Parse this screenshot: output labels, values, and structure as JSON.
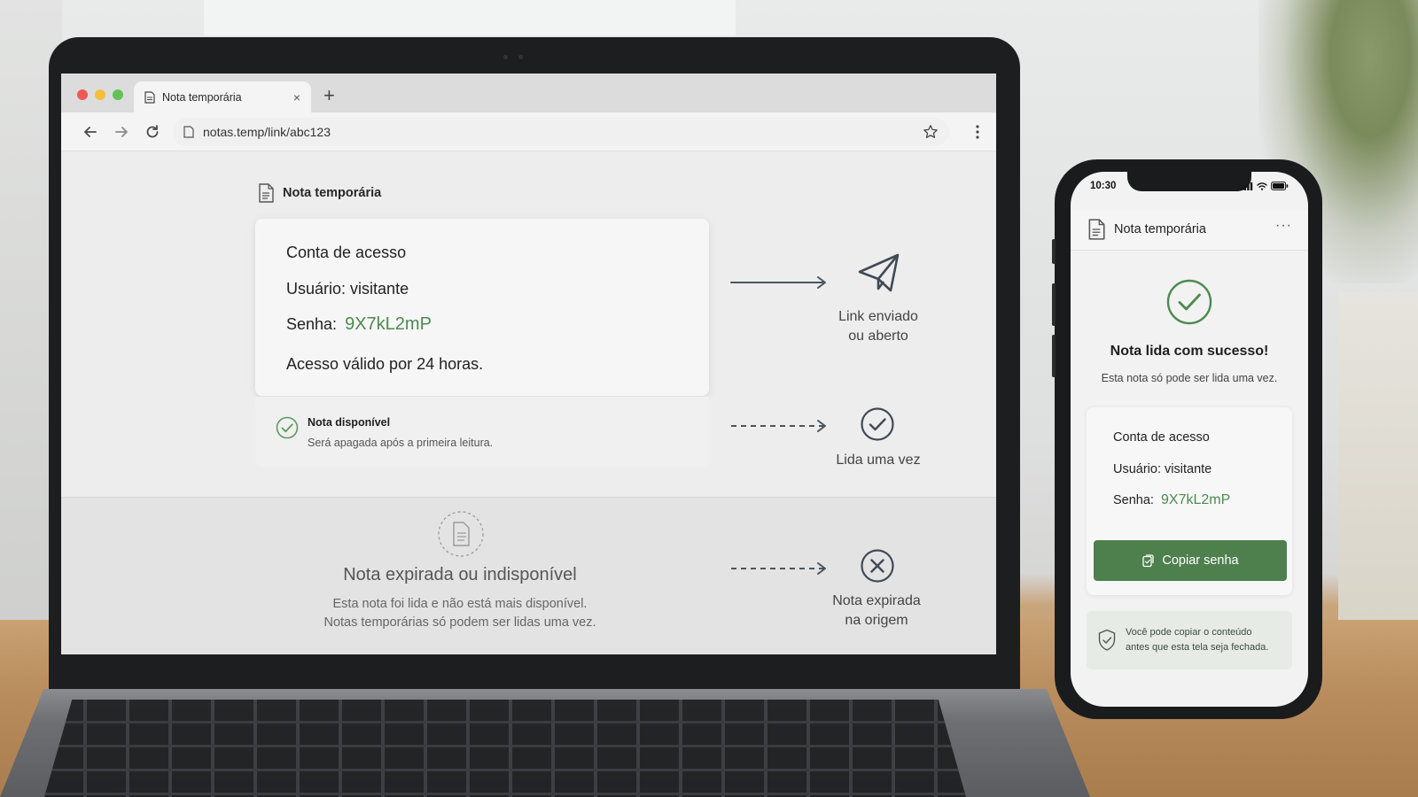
{
  "browser": {
    "tab_title": "Nota temporária",
    "tab_close": "×",
    "new_tab": "+",
    "url": "notas.temp/link/abc123"
  },
  "page": {
    "header": "Nota temporária",
    "card": {
      "title": "Conta de acesso",
      "user_label": "Usuário:",
      "user_value": "visitante",
      "pass_label": "Senha:",
      "pass_value": "9X7kL2mP",
      "validity": "Acesso válido por 24 horas."
    },
    "status": {
      "title": "Nota disponível",
      "subtitle": "Será apagada após a primeira leitura."
    },
    "flow": {
      "step1_line1": "Link enviado",
      "step1_line2": "ou aberto",
      "step2": "Lida uma vez",
      "step3_line1": "Nota expirada",
      "step3_line2": "na origem"
    },
    "expired": {
      "title": "Nota expirada ou indisponível",
      "line1": "Esta nota foi lida e não está mais disponível.",
      "line2": "Notas temporárias só podem ser lidas uma vez."
    }
  },
  "phone": {
    "time": "10:30",
    "header_title": "Nota temporária",
    "more": "···",
    "success_title": "Nota lida com sucesso!",
    "once_text": "Esta nota só pode ser lida uma vez.",
    "card": {
      "title": "Conta de acesso",
      "user_label": "Usuário:",
      "user_value": "visitante",
      "pass_label": "Senha:",
      "pass_value": "9X7kL2mP"
    },
    "copy_button": "Copiar senha",
    "info_line1": "Você pode copiar o conteúdo",
    "info_line2": "antes que esta tela seja fechada."
  },
  "colors": {
    "accent_green": "#4d804d",
    "password_green": "#4d8a4f"
  }
}
